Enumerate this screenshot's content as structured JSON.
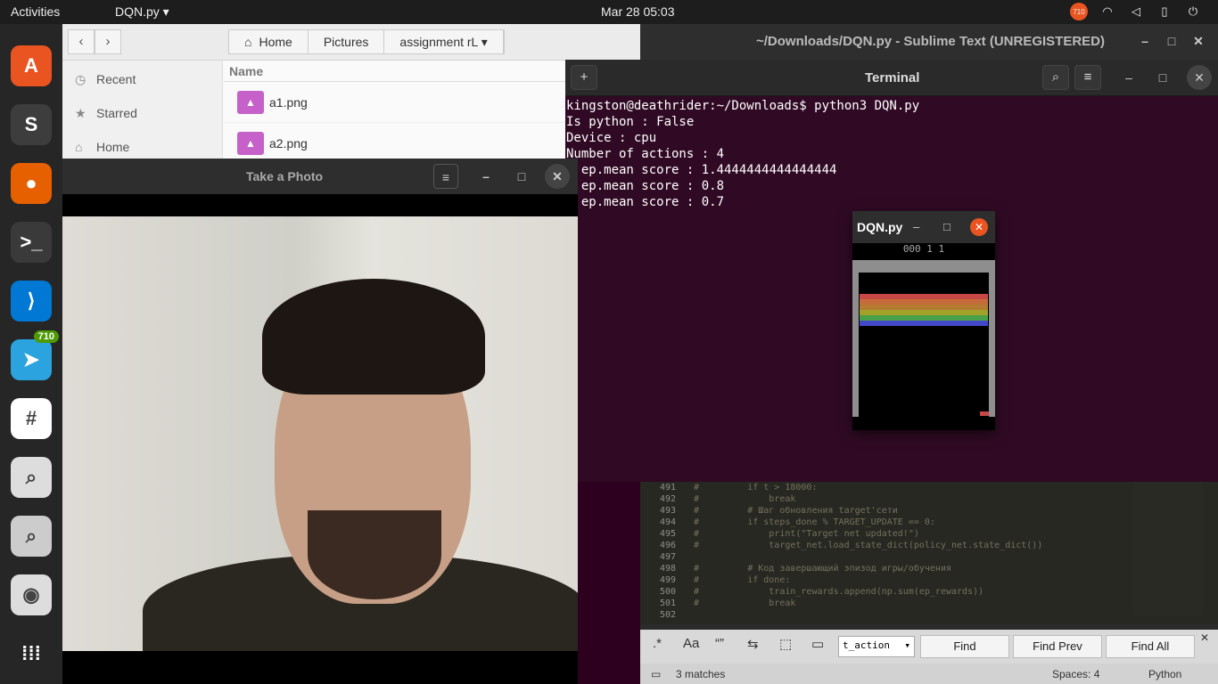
{
  "topbar": {
    "activities": "Activities",
    "app_menu": "DQN.py ▾",
    "clock": "Mar 28  05:03",
    "tray": [
      "710",
      "wifi",
      "vol",
      "bat",
      "⏻"
    ]
  },
  "dock": {
    "items": [
      {
        "name": "software-center-icon",
        "glyph": "A",
        "color": "#e95420"
      },
      {
        "name": "sublime-icon",
        "glyph": "S",
        "color": "#3d3d3d"
      },
      {
        "name": "firefox-icon",
        "glyph": "●",
        "color": "#e66000"
      },
      {
        "name": "terminal-icon",
        "glyph": ">_",
        "color": "#3a3a3a"
      },
      {
        "name": "vscode-icon",
        "glyph": "⟩",
        "color": "#0078d4"
      },
      {
        "name": "telegram-icon",
        "glyph": "➤",
        "color": "#2aa3de",
        "badge": "710"
      },
      {
        "name": "slack-icon",
        "glyph": "#",
        "color": "#fff"
      },
      {
        "name": "magnifier-icon",
        "glyph": "⌕",
        "color": "#ddd"
      },
      {
        "name": "search-app-icon",
        "glyph": "⌕",
        "color": "#ccc"
      },
      {
        "name": "camera-icon",
        "glyph": "◉",
        "color": "#ddd"
      },
      {
        "name": "show-apps-icon",
        "glyph": "⁞⁞⁞",
        "color": "#262626"
      }
    ]
  },
  "files": {
    "crumbs": [
      "Home",
      "Pictures",
      "assignment rL"
    ],
    "sidebar": [
      "Recent",
      "Starred",
      "Home"
    ],
    "col_name": "Name",
    "rows": [
      "a1.png",
      "a2.png"
    ]
  },
  "camera": {
    "title": "Take a Photo"
  },
  "terminal": {
    "title": "Terminal",
    "lines": [
      "kingston@deathrider:~/Downloads$ python3 DQN.py",
      "Is python : False",
      "Device : cpu",
      "Number of actions : 4",
      ") ep.mean score : 1.4444444444444444",
      ") ep.mean score : 0.8",
      ") ep.mean score : 0.7"
    ]
  },
  "sublime": {
    "title": "~/Downloads/DQN.py - Sublime Text (UNREGISTERED)",
    "line_numbers": [
      "491",
      "492",
      "493",
      "494",
      "495",
      "496",
      "497",
      "498",
      "499",
      "500",
      "501",
      "502"
    ],
    "code": [
      "#         if t > 18000:",
      "#             break",
      "#         # Шаг обновления target'сети",
      "#         if steps_done % TARGET_UPDATE == 0:",
      "#             print(\"Target net updated!\")",
      "#             target_net.load_state_dict(policy_net.state_dict())",
      "",
      "#         # Код завершающий эпизод игры/обучения",
      "#         if done:",
      "#             train_rewards.append(np.sum(ep_rewards))",
      "#             break",
      ""
    ],
    "find": {
      "regex": ".*",
      "case": "Aa",
      "word": "“”",
      "value": "t_action",
      "find": "Find",
      "find_prev": "Find Prev",
      "find_all": "Find All"
    },
    "status": {
      "matches": "3 matches",
      "spaces": "Spaces: 4",
      "syntax": "Python"
    }
  },
  "game": {
    "title": "DQN.py",
    "score_text": "000  1  1",
    "brick_colors": [
      "#c84848",
      "#c66c3a",
      "#b47a30",
      "#a2a22a",
      "#48a048",
      "#4248c8"
    ]
  }
}
